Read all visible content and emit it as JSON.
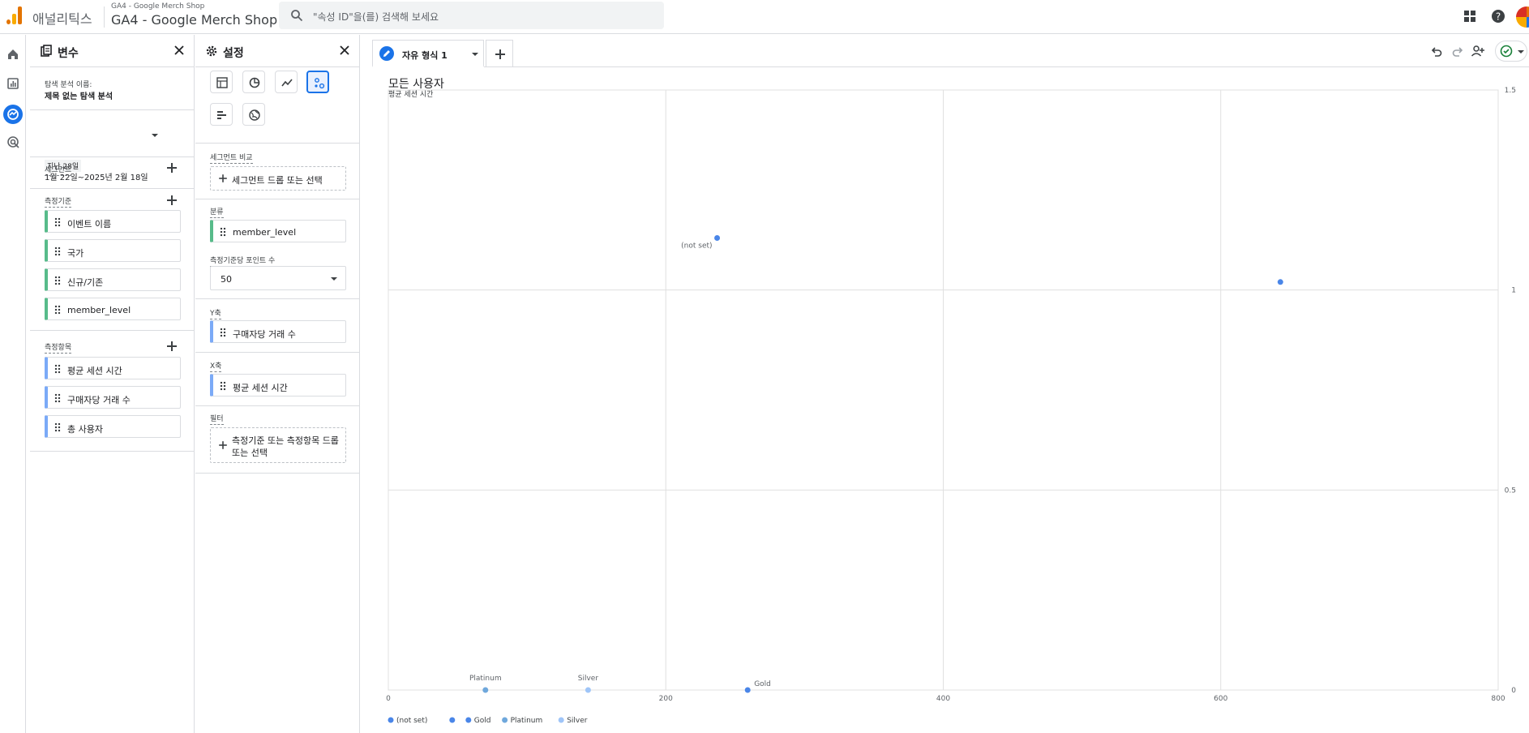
{
  "topbar": {
    "brand": "애널리틱스",
    "account_small": "GA4 - Google Merch Shop",
    "account_big": "GA4 - Google Merch Shop",
    "search_placeholder": "\"속성 ID\"을(를) 검색해 보세요"
  },
  "variables": {
    "title": "변수",
    "exploration_label": "탐색 분석 이름:",
    "exploration_name": "제목 없는 탐색 분석",
    "date_tag": "지난 28일",
    "date_range": "1월 22일~2025년 2월 18일",
    "segments_label": "세그먼트",
    "dimensions_label": "측정기준",
    "dimensions": [
      "이벤트 이름",
      "국가",
      "신규/기존",
      "member_level"
    ],
    "metrics_label": "측정항목",
    "metrics": [
      "평균 세션 시간",
      "구매자당 거래 수",
      "총 사용자"
    ]
  },
  "settings": {
    "title": "설정",
    "segment_compare_label": "세그먼트 비교",
    "segment_drop": "세그먼트 드롭 또는 선택",
    "breakdown_label": "분류",
    "breakdown_value": "member_level",
    "points_label": "측정기준당 포인트 수",
    "points_value": "50",
    "y_label": "Y축",
    "y_value": "구매자당 거래 수",
    "x_label": "X축",
    "x_value": "평균 세션 시간",
    "filter_label": "필터",
    "filter_line1": "측정기준 또는 측정항목 드롭",
    "filter_line2": "또는 선택"
  },
  "canvas": {
    "tab_label": "자유 형식 1",
    "chart_title": "모든 사용자"
  },
  "colors": {
    "accent": "#1a73e8",
    "dimension_bar": "#57bb8a",
    "metric_bar": "#7baaf7",
    "point_blue": "#4a86e8",
    "point_light": "#9fc5f8"
  },
  "chart_data": {
    "type": "scatter",
    "title": "모든 사용자",
    "ylabel": "평균 세션 시간",
    "xlim": [
      0,
      800
    ],
    "ylim": [
      0,
      1.5
    ],
    "x_ticks": [
      "0",
      "200",
      "400",
      "600",
      "800"
    ],
    "y_ticks": [
      "0",
      "0.5",
      "1",
      "1.5"
    ],
    "grid": true,
    "legend": "bottom-left",
    "legend_entries": [
      {
        "label": "(not set)",
        "color": "#4a86e8"
      },
      {
        "label": "",
        "color": "#4a86e8"
      },
      {
        "label": "Gold",
        "color": "#4a86e8"
      },
      {
        "label": "Platinum",
        "color": "#6fa8dc"
      },
      {
        "label": "Silver",
        "color": "#9fc5f8"
      }
    ],
    "points": [
      {
        "x": 237,
        "y": 1.13,
        "label": "(not set)",
        "color": "#4a86e8"
      },
      {
        "x": 643,
        "y": 1.02,
        "label": "",
        "color": "#4a86e8"
      },
      {
        "x": 259,
        "y": 0,
        "label": "Gold",
        "color": "#4a86e8"
      },
      {
        "x": 70,
        "y": 0,
        "label": "Platinum",
        "color": "#6fa8dc"
      },
      {
        "x": 144,
        "y": 0,
        "label": "Silver",
        "color": "#9fc5f8"
      }
    ]
  }
}
